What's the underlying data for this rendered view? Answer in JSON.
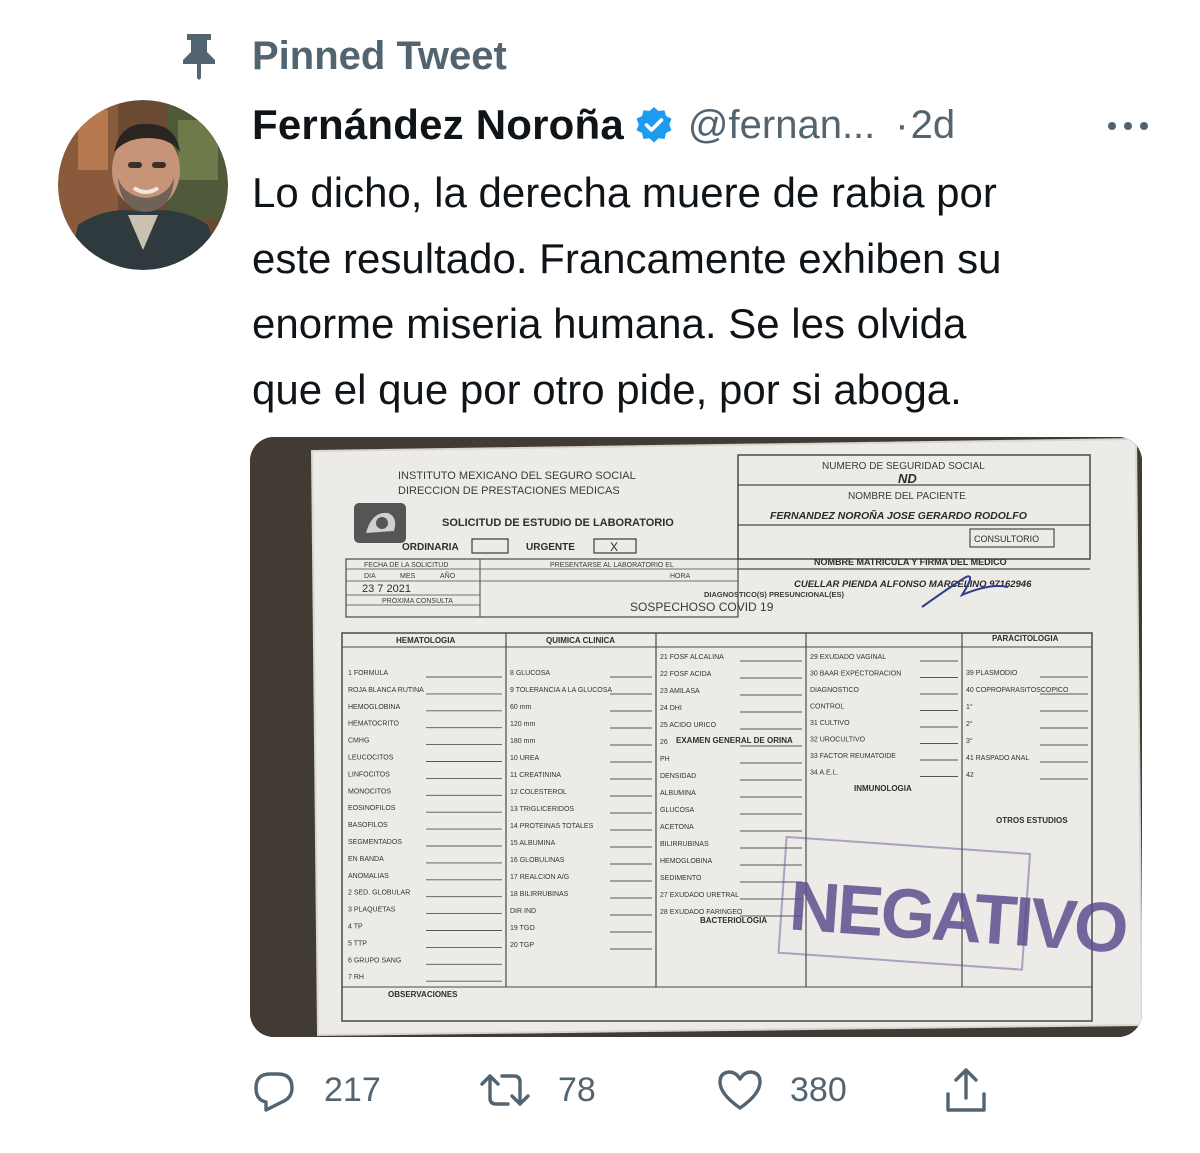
{
  "pinned": {
    "label": "Pinned Tweet",
    "icon": "pin-icon"
  },
  "author": {
    "name": "Fernández Noroña",
    "handle": "@fernan...",
    "verified_icon": "verified-badge-icon",
    "separator": "·",
    "time": "2d"
  },
  "tweet": {
    "lines": [
      "Lo dicho, la derecha muere de rabia por",
      "este resultado. Francamente exhiben su",
      "enorme miseria humana. Se les olvida",
      "que el que por otro pide, por si aboga."
    ]
  },
  "media": {
    "form": {
      "inst_line1": "INSTITUTO MEXICANO DEL SEGURO SOCIAL",
      "inst_line2": "DIRECCION DE PRESTACIONES MEDICAS",
      "title": "SOLICITUD DE ESTUDIO DE LABORATORIO",
      "nss_label": "NUMERO DE SEGURIDAD SOCIAL",
      "nss_value": "ND",
      "patient_label": "NOMBRE DEL PACIENTE",
      "patient_value": "FERNANDEZ NOROÑA JOSE GERARDO RODOLFO",
      "consultorio": "CONSULTORIO",
      "ordinaria": "ORDINARIA",
      "urgente": "URGENTE",
      "urgente_mark": "X",
      "medico_label": "NOMBRE MATRICULA Y FIRMA DEL MEDICO",
      "medico_value": "CUELLAR PIENDA ALFONSO MARCELINO 97162946",
      "fecha_label": "FECHA DE LA SOLICITUD",
      "presentarse_label": "PRESENTARSE AL LABORATORIO EL",
      "fecha_value": "23   7   2021",
      "dia": "DIA",
      "mes": "MES",
      "anio": "AÑO",
      "hora": "HORA",
      "proxima_label": "PROXIMA CONSULTA",
      "diagnostico_label": "DIAGNOSTICO(S) PRESUNCIONAL(ES)",
      "diagnostico_value": "SOSPECHOSO COVID 19",
      "sec_hematologia": "HEMATOLOGIA",
      "sec_quimica": "QUIMICA CLINICA",
      "sec_parasitologia": "PARACITOLOGIA",
      "sec_inmunologia": "INMUNOLOGIA",
      "sec_orina": "EXAMEN GENERAL DE ORINA",
      "sec_bacteriologia": "BACTERIOLOGIA",
      "sec_otros": "OTROS ESTUDIOS",
      "observaciones": "OBSERVACIONES",
      "stamp": "NEGATIVO",
      "col1": [
        "1 FORMULA",
        "ROJA   BLANCA  RUTINA",
        "HEMOGLOBINA",
        "HEMATOCRITO",
        "CMHG",
        "LEUCOCITOS",
        "LINFOCITOS",
        "MONOCITOS",
        "EOSINOFILOS",
        "BASOFILOS",
        "SEGMENTADOS",
        "EN BANDA",
        "ANOMALIAS",
        "2 SED. GLOBULAR",
        "3 PLAQUETAS",
        "4 TP",
        "5 TTP",
        "6 GRUPO SANG",
        "7 RH"
      ],
      "col2": [
        "8 GLUCOSA",
        "9 TOLERANCIA A LA GLUCOSA",
        "60 mm",
        "120 mm",
        "180 mm",
        "10 UREA",
        "11 CREATININA",
        "12 COLESTEROL",
        "13 TRIGLICERIDOS",
        "14 PROTEINAS TOTALES",
        "15 ALBUMINA",
        "16 GLOBULINAS",
        "17 REALCION A/G",
        "18 BILIRRUBINAS",
        "DIR     IND",
        "19 TGO",
        "20 TGP"
      ],
      "col3": [
        "21 FOSF ALCALINA",
        "22 FOSF ACIDA",
        "23 AMILASA",
        "24 DHI",
        "25 ACIDO URICO",
        "26",
        "PH",
        "DENSIDAD",
        "ALBUMINA",
        "GLUCOSA",
        "ACETONA",
        "BILIRRUBINAS",
        "HEMOGLOBINA",
        "SEDIMENTO",
        "27 EXUDADO URETRAL",
        "28 EXUDADO FARINGEO"
      ],
      "col4": [
        "29 EXUDADO VAGINAL",
        "30 BAAR EXPECTORACION",
        "DIAGNOSTICO",
        "CONTROL",
        "31 CULTIVO",
        "32 UROCULTIVO",
        "33 FACTOR REUMATOIDE",
        "34 A.E.L."
      ],
      "col5": [
        "39 PLASMODIO",
        "40 COPROPARASITOSCOPICO",
        "1°",
        "2°",
        "3°",
        "41 RASPADO ANAL",
        "42"
      ]
    }
  },
  "actions": {
    "reply_count": "217",
    "retweet_count": "78",
    "like_count": "380"
  },
  "colors": {
    "secondary_text": "#536471",
    "verified_blue": "#1d9bf0",
    "stamp_purple": "#5a4a8c"
  }
}
